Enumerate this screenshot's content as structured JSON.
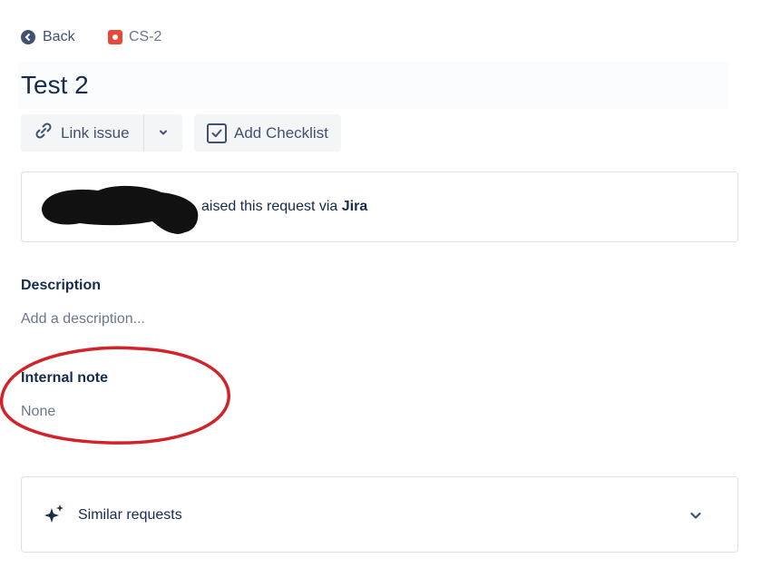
{
  "nav": {
    "back_label": "Back",
    "issue_key": "CS-2",
    "issue_type_color": "#e5493a"
  },
  "issue": {
    "title": "Test 2"
  },
  "actions": {
    "link_issue_label": "Link issue",
    "add_checklist_label": "Add Checklist"
  },
  "raised": {
    "text_prefix": "aised this request via ",
    "channel": "Jira"
  },
  "fields": {
    "description": {
      "label": "Description",
      "placeholder": "Add a description..."
    },
    "internal_note": {
      "label": "Internal note",
      "value": "None"
    }
  },
  "similar": {
    "label": "Similar requests"
  },
  "colors": {
    "text_primary": "#172b4d",
    "text_subtle": "#6b778c",
    "annotation": "#d1232a"
  },
  "icons": [
    "arrow-left-circle-icon",
    "issue-type-icon",
    "link-icon",
    "chevron-down-icon",
    "checkbox-checked-icon",
    "sparkle-icon"
  ]
}
